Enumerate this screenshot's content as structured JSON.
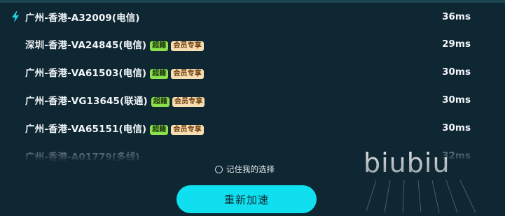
{
  "servers": [
    {
      "name": "广州-香港-A32009(电信)",
      "latency": "36ms",
      "badges": [],
      "active": true,
      "icon": "lightning-icon"
    },
    {
      "name": "深圳-香港-VA24845(电信)",
      "latency": "29ms",
      "badges": [
        "超籍",
        "会员专享"
      ],
      "active": false
    },
    {
      "name": "广州-香港-VA61503(电信)",
      "latency": "30ms",
      "badges": [
        "超籍",
        "会员专享"
      ],
      "active": false
    },
    {
      "name": "广州-香港-VG13645(联通)",
      "latency": "30ms",
      "badges": [
        "超籍",
        "会员专享"
      ],
      "active": false
    },
    {
      "name": "广州-香港-VA65151(电信)",
      "latency": "30ms",
      "badges": [
        "超籍",
        "会员专享"
      ],
      "active": false
    },
    {
      "name": "广州-香港-A01779(多线)",
      "latency": "32ms",
      "badges": [],
      "active": false
    }
  ],
  "remember": {
    "label": "记住我的选择",
    "checked": false
  },
  "accelerate_button": {
    "label": "重新加速"
  },
  "watermark": {
    "text": "biubiu"
  },
  "colors": {
    "background": "#0f2733",
    "accent": "#10dfef",
    "lightning": "#21d3ea",
    "super_badge": "#8ce04b",
    "member_badge": "#f8ddb2"
  }
}
